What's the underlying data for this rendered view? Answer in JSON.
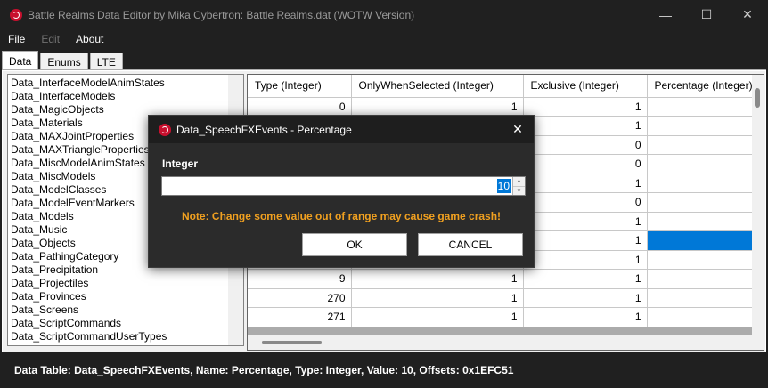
{
  "window": {
    "title": "Battle Realms Data Editor by Mika Cybertron: Battle Realms.dat (WOTW Version)",
    "controls": {
      "minimize": "—",
      "maximize": "☐",
      "close": "✕"
    }
  },
  "menu": {
    "file": "File",
    "edit": "Edit",
    "about": "About"
  },
  "tabs": [
    "Data",
    "Enums",
    "LTE"
  ],
  "table_list": [
    "Data_InterfaceModelAnimStates",
    "Data_InterfaceModels",
    "Data_MagicObjects",
    "Data_Materials",
    "Data_MAXJointProperties",
    "Data_MAXTriangleProperties",
    "Data_MiscModelAnimStates",
    "Data_MiscModels",
    "Data_ModelClasses",
    "Data_ModelEventMarkers",
    "Data_Models",
    "Data_Music",
    "Data_Objects",
    "Data_PathingCategory",
    "Data_Precipitation",
    "Data_Projectiles",
    "Data_Provinces",
    "Data_Screens",
    "Data_ScriptCommands",
    "Data_ScriptCommandUserTypes"
  ],
  "grid": {
    "columns": [
      "Type (Integer)",
      "OnlyWhenSelected (Integer)",
      "Exclusive (Integer)",
      "Percentage (Integer)"
    ],
    "rows": [
      [
        "0",
        "1",
        "1",
        ""
      ],
      [
        "",
        "",
        "1",
        ""
      ],
      [
        "",
        "",
        "0",
        ""
      ],
      [
        "",
        "",
        "0",
        ""
      ],
      [
        "",
        "",
        "1",
        ""
      ],
      [
        "",
        "",
        "0",
        ""
      ],
      [
        "",
        "",
        "1",
        ""
      ],
      [
        "",
        "",
        "1",
        ""
      ],
      [
        "",
        "",
        "1",
        ""
      ],
      [
        "9",
        "1",
        "1",
        ""
      ],
      [
        "270",
        "1",
        "1",
        ""
      ],
      [
        "271",
        "1",
        "1",
        ""
      ]
    ],
    "selected_row": 7
  },
  "status": {
    "text": "Data Table: Data_SpeechFXEvents, Name: Percentage, Type: Integer, Value: 10, Offsets: 0x1EFC51"
  },
  "dialog": {
    "title": "Data_SpeechFXEvents - Percentage",
    "close": "✕",
    "label": "Integer",
    "value": "10",
    "note": "Note: Change some value out of range may cause game crash!",
    "ok": "OK",
    "cancel": "CANCEL"
  },
  "colors": {
    "accent": "#0078d7",
    "warning": "#f0a020",
    "icon": "#c8102e"
  }
}
